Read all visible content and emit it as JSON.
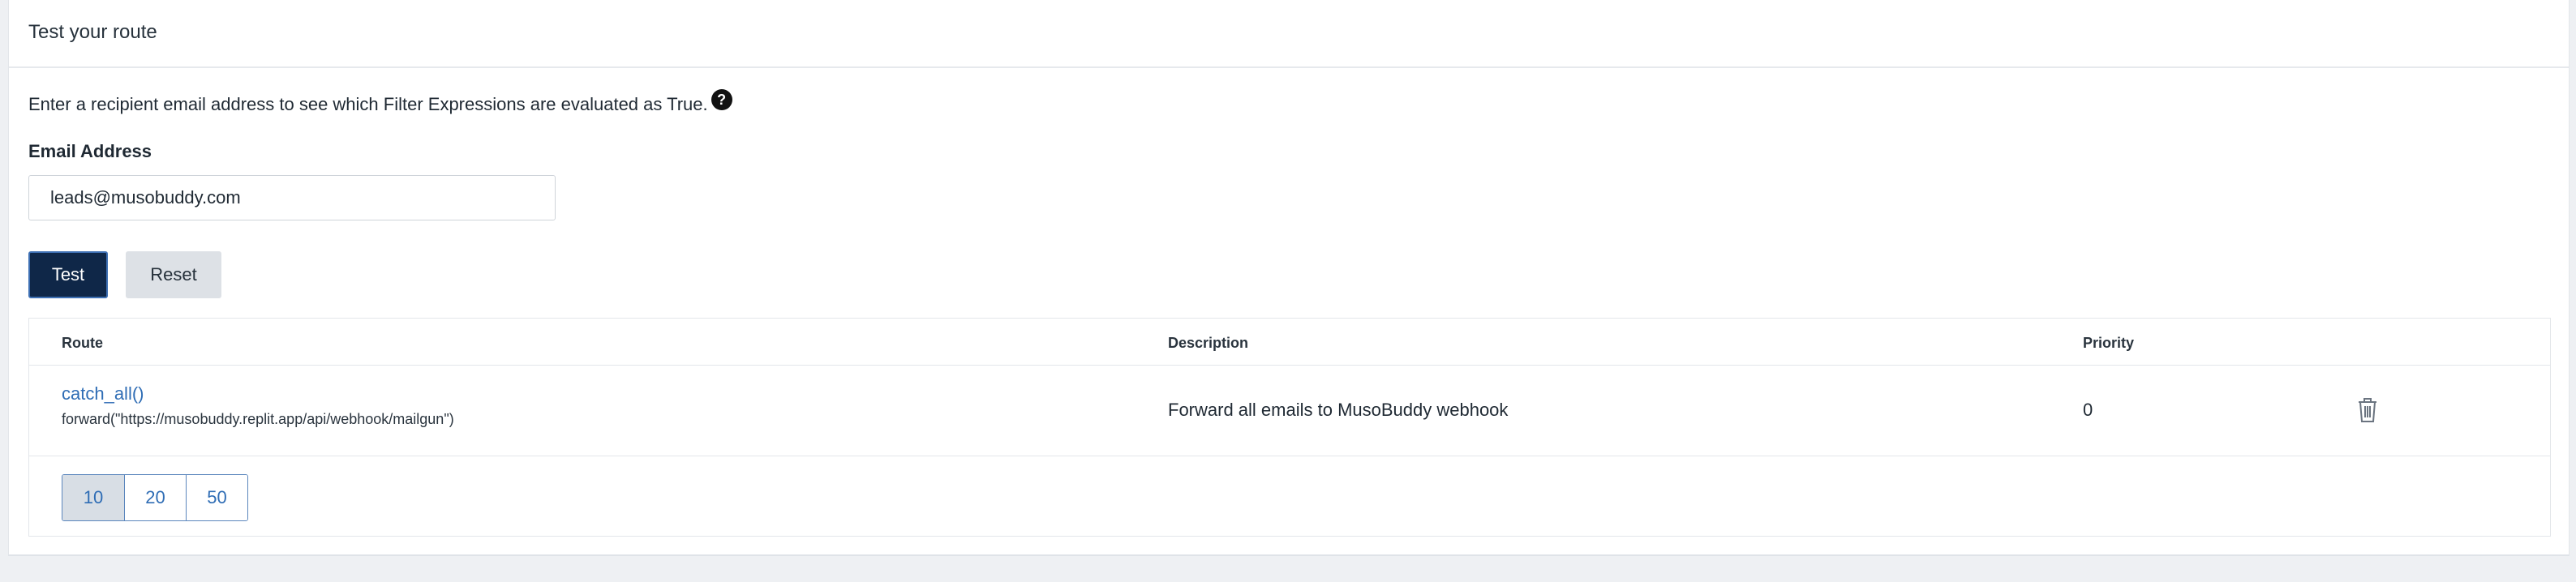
{
  "card": {
    "title": "Test your route"
  },
  "intro": {
    "text": "Enter a recipient email address to see which Filter Expressions are evaluated as True.",
    "help_icon": "question-circle-icon"
  },
  "form": {
    "email_label": "Email Address",
    "email_value": "leads@musobuddy.com",
    "test_label": "Test",
    "reset_label": "Reset"
  },
  "table": {
    "headers": {
      "route": "Route",
      "description": "Description",
      "priority": "Priority"
    },
    "rows": [
      {
        "route": "catch_all()",
        "action": "forward(\"https://musobuddy.replit.app/api/webhook/mailgun\")",
        "description": "Forward all emails to MusoBuddy webhook",
        "priority": "0",
        "delete_icon": "trash-icon"
      }
    ]
  },
  "pagination": {
    "options": [
      "10",
      "20",
      "50"
    ],
    "selected": "10"
  },
  "colors": {
    "primary_button": "#0f2748",
    "link": "#2f6db5",
    "page_bg": "#eef0f3"
  }
}
